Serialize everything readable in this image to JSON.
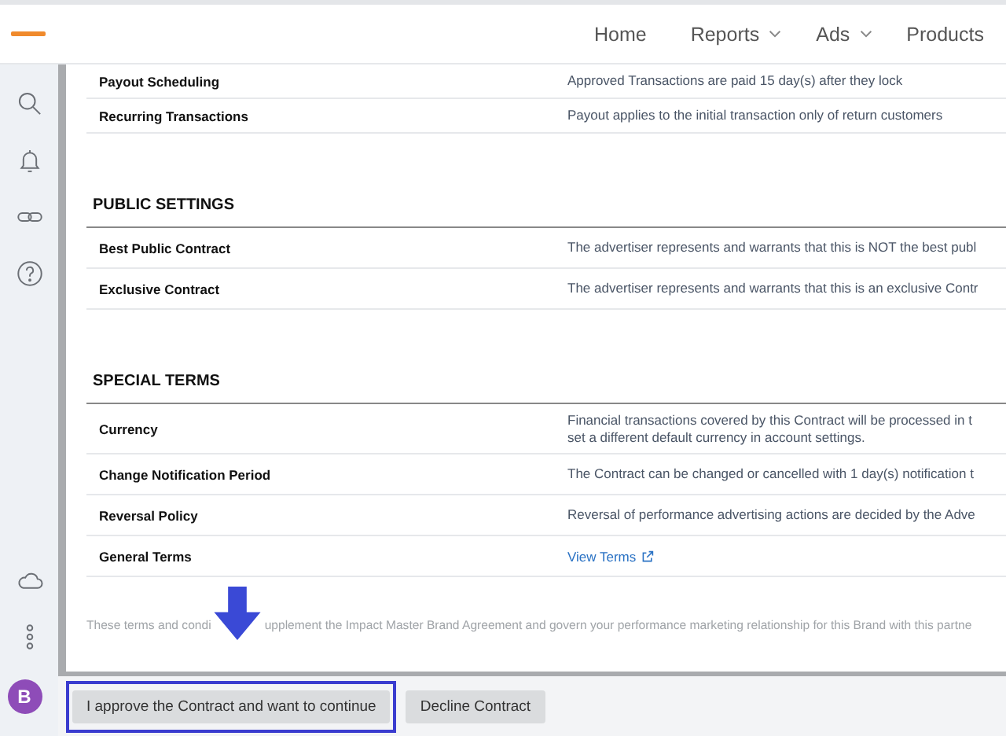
{
  "nav": [
    {
      "label": "Home",
      "dropdown": false
    },
    {
      "label": "Reports",
      "dropdown": true
    },
    {
      "label": "Ads",
      "dropdown": true
    },
    {
      "label": "Products",
      "dropdown": false
    }
  ],
  "sidebar": {
    "avatar": "B"
  },
  "sections": [
    {
      "rows": [
        {
          "label": "Payout Scheduling",
          "value": "Approved Transactions are paid 15 day(s) after they lock",
          "kind": "text"
        },
        {
          "label": "Recurring Transactions",
          "value": "Payout applies to the initial transaction only of return customers",
          "kind": "text"
        }
      ]
    },
    {
      "heading": "PUBLIC SETTINGS",
      "rows": [
        {
          "label": "Best Public Contract",
          "value": "The advertiser represents and warrants that this is NOT the best publ",
          "kind": "text"
        },
        {
          "label": "Exclusive Contract",
          "value": "The advertiser represents and warrants that this is an exclusive Contr",
          "kind": "text"
        }
      ]
    },
    {
      "heading": "SPECIAL TERMS",
      "rows": [
        {
          "label": "Currency",
          "value": "Financial transactions covered by this Contract will be processed in t\nset a different default currency in account settings.",
          "kind": "text"
        },
        {
          "label": "Change Notification Period",
          "value": "The Contract can be changed or cancelled with 1 day(s) notification t",
          "kind": "text"
        },
        {
          "label": "Reversal Policy",
          "value": "Reversal of performance advertising actions are decided by the Adve",
          "kind": "text"
        },
        {
          "label": "General Terms",
          "value": "View Terms",
          "kind": "link"
        }
      ]
    }
  ],
  "footnote": [
    "These terms and condi",
    "upplement the Impact Master Brand Agreement and govern your performance marketing relationship for this Brand with this partne"
  ],
  "buttons": [
    {
      "label": "I approve the Contract and want to continue",
      "highlighted": true
    },
    {
      "label": "Decline Contract",
      "highlighted": false
    }
  ]
}
